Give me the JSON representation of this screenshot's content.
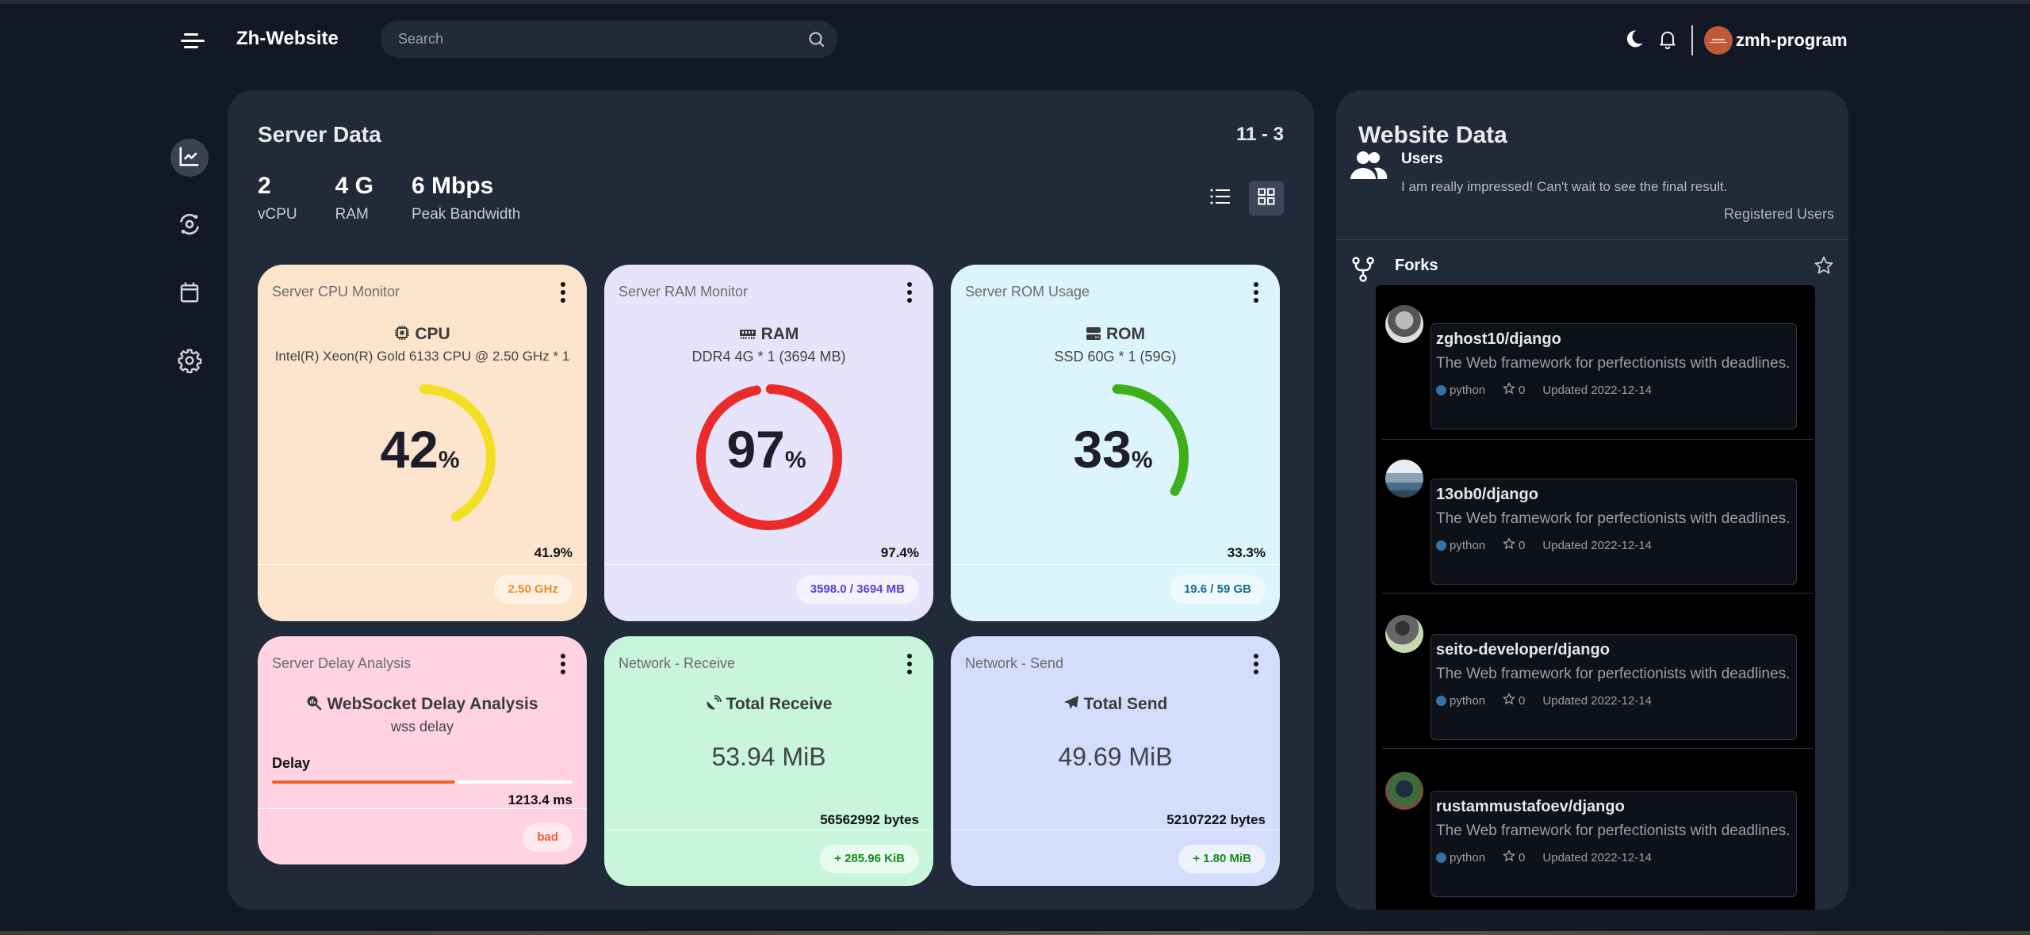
{
  "header": {
    "brand": "Zh-Website",
    "search_placeholder": "Search",
    "username": "zmh-program"
  },
  "sidebar": {
    "items": [
      {
        "name": "analytics",
        "icon": "chart-line-icon",
        "active": true
      },
      {
        "name": "sync",
        "icon": "orbit-icon",
        "active": false
      },
      {
        "name": "calendar",
        "icon": "calendar-icon",
        "active": false
      },
      {
        "name": "settings",
        "icon": "gear-icon",
        "active": false
      }
    ]
  },
  "server": {
    "title": "Server Data",
    "date": "11 - 3",
    "stats": [
      {
        "value": "2",
        "label": "vCPU"
      },
      {
        "value": "4 G",
        "label": "RAM"
      },
      {
        "value": "6 Mbps",
        "label": "Peak Bandwidth"
      }
    ],
    "cpu": {
      "title": "Server CPU Monitor",
      "heading": "CPU",
      "sub": "Intel(R) Xeon(R) Gold 6133 CPU @ 2.50 GHz * 1",
      "value": "42",
      "percent_sign": "%",
      "fraction": 0.419,
      "exact": "41.9%",
      "badge": "2.50 GHz",
      "color": "#f3df22",
      "bg": "#fde4cc",
      "badge_color": "#f08a2a"
    },
    "ram": {
      "title": "Server RAM Monitor",
      "heading": "RAM",
      "sub": "DDR4 4G * 1 (3694 MB)",
      "value": "97",
      "percent_sign": "%",
      "fraction": 0.974,
      "exact": "97.4%",
      "badge": "3598.0 / 3694 MB",
      "color": "#ec2a2a",
      "bg": "#e6e4fa",
      "badge_color": "#5b3fd8"
    },
    "rom": {
      "title": "Server ROM Usage",
      "heading": "ROM",
      "sub": "SSD 60G * 1 (59G)",
      "value": "33",
      "percent_sign": "%",
      "fraction": 0.333,
      "exact": "33.3%",
      "badge": "19.6 / 59 GB",
      "color": "#3eaf1a",
      "bg": "#dcf5fc",
      "badge_color": "#1a6a8a"
    },
    "delay": {
      "title": "Server Delay Analysis",
      "heading": "WebSocket Delay Analysis",
      "sub": "wss delay",
      "label": "Delay",
      "fraction": 0.61,
      "value": "1213.4 ms",
      "badge": "bad",
      "bg": "#ffd3e1",
      "badge_color": "#f0602c"
    },
    "receive": {
      "title": "Network - Receive",
      "heading": "Total Receive",
      "value": "53.94 MiB",
      "bytes": "56562992 bytes",
      "badge": "+ 285.96 KiB",
      "bg": "#c9f5dc",
      "badge_color": "#1a8a1a"
    },
    "send": {
      "title": "Network - Send",
      "heading": "Total Send",
      "value": "49.69 MiB",
      "bytes": "52107222 bytes",
      "badge": "+ 1.80 MiB",
      "bg": "#d4defc",
      "badge_color": "#1a8a1a"
    }
  },
  "website": {
    "title": "Website Data",
    "users_title": "Users",
    "users_desc": "I am really impressed! Can't wait to see the final result.",
    "users_caption": "Registered Users",
    "forks_title": "Forks",
    "forks": [
      {
        "name": "zghost10/django",
        "desc": "The Web framework for perfectionists with deadlines.",
        "lang": "python",
        "stars": "0",
        "updated": "Updated 2022-12-14"
      },
      {
        "name": "13ob0/django",
        "desc": "The Web framework for perfectionists with deadlines.",
        "lang": "python",
        "stars": "0",
        "updated": "Updated 2022-12-14"
      },
      {
        "name": "seito-developer/django",
        "desc": "The Web framework for perfectionists with deadlines.",
        "lang": "python",
        "stars": "0",
        "updated": "Updated 2022-12-14"
      },
      {
        "name": "rustammustafoev/django",
        "desc": "The Web framework for perfectionists with deadlines.",
        "lang": "python",
        "stars": "0",
        "updated": "Updated 2022-12-14"
      }
    ]
  }
}
